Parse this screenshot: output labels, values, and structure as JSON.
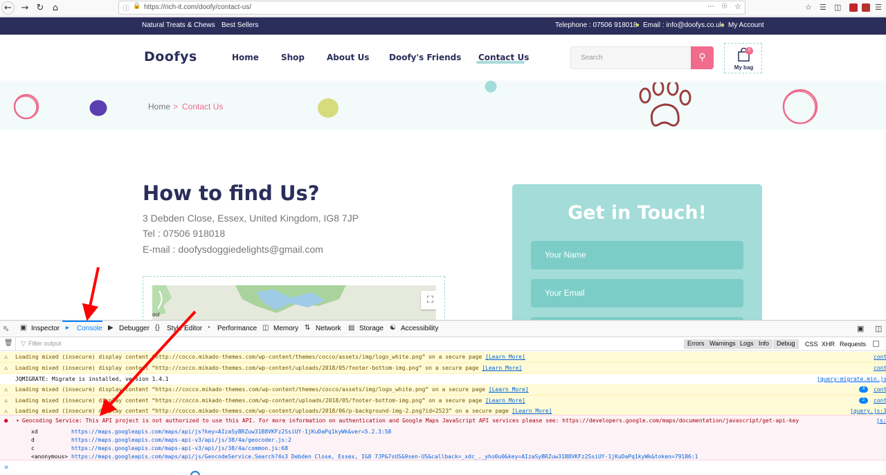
{
  "browser": {
    "url": "https://rich-it.com/doofy/contact-us/",
    "back_icon": "back-arrow-icon",
    "forward_icon": "forward-arrow-icon"
  },
  "topbar": {
    "left": [
      "Natural Treats & Chews",
      "Best Sellers"
    ],
    "telephone": "Telephone : 07506 918018",
    "email": "Email : info@doofys.co.uk",
    "account": "My Account"
  },
  "header": {
    "logo": "Doofys",
    "nav": [
      "Home",
      "Shop",
      "About Us",
      "Doofy's Friends",
      "Contact Us"
    ],
    "search_placeholder": "Search",
    "bag_label": "My bag",
    "bag_count": "0"
  },
  "breadcrumb": {
    "home": "Home",
    "separator": ">",
    "current": "Contact Us"
  },
  "content": {
    "title": "How to find Us?",
    "address": "3 Debden Close, Essex, United Kingdom, IG8 7JP",
    "tel": "Tel : 07506 918018",
    "email": "E-mail : doofysdoggiedelights@gmail.com",
    "map_label": "ool"
  },
  "contact_form": {
    "title": "Get in Touch!",
    "name_placeholder": "Your Name",
    "email_placeholder": "Your Email"
  },
  "devtools": {
    "tabs": [
      "Inspector",
      "Console",
      "Debugger",
      "Style Editor",
      "Performance",
      "Memory",
      "Network",
      "Storage",
      "Accessibility"
    ],
    "filter_placeholder": "Filter output",
    "filters": [
      "Errors",
      "Warnings",
      "Logs",
      "Info",
      "Debug"
    ],
    "filters_right": [
      "CSS",
      "XHR",
      "Requests"
    ],
    "messages": [
      {
        "type": "warn",
        "text": "Loading mixed (insecure) display content “http://cocco.mikado-themes.com/wp-content/themes/cocco/assets/img/logo_white.png” on a secure page",
        "link": "[Learn More]",
        "src": "cont"
      },
      {
        "type": "warn",
        "text": "Loading mixed (insecure) display content “http://cocco.mikado-themes.com/wp-content/uploads/2018/05/footer-bottom-img.png” on a secure page",
        "link": "[Learn More]",
        "src": "cont"
      },
      {
        "type": "plain",
        "text": "JQMIGRATE: Migrate is installed, version 1.4.1",
        "link": "",
        "src": "jquery-migrate.min.js"
      },
      {
        "type": "warn",
        "text": "Loading mixed (insecure) display content “https://cocco.mikado-themes.com/wp-content/themes/cocco/assets/img/logo_white.png” on a secure page",
        "link": "[Learn More]",
        "src": "cont",
        "count": "4"
      },
      {
        "type": "warn",
        "text": "Loading mixed (insecure) display content “https://cocco.mikado-themes.com/wp-content/uploads/2018/05/footer-bottom-img.png” on a secure page",
        "link": "[Learn More]",
        "src": "cont",
        "count": "2"
      },
      {
        "type": "warn",
        "text": "Loading mixed (insecure) display content “http://cocco.mikado-themes.com/wp-content/uploads/2018/06/p-background-img-2.png?id=2523” on a secure page",
        "link": "[Learn More]",
        "src": "jquery.js:3"
      }
    ],
    "error": {
      "text": "Geocoding Service: This API project is not authorized to use this API.  For more information on authentication and Google Maps JavaScript API services please see: https://developers.google.com/maps/documentation/javascript/get-api-key",
      "src": "js:",
      "stack": [
        {
          "fn": "xd",
          "url": "https://maps.googleapis.com/maps/api/js?key=AIzaSyBRZuw31B8VKFz2SsiUY-1jKuDaPq1kyWk&ver=5.2.3:58"
        },
        {
          "fn": "d",
          "url": "https://maps.googleapis.com/maps-api-v3/api/js/38/4a/geocoder.js:2"
        },
        {
          "fn": "c",
          "url": "https://maps.googleapis.com/maps-api-v3/api/js/38/4a/common.js:68"
        },
        {
          "fn": "<anonymous>",
          "url": "https://maps.googleapis.com/maps/api/js/GeocodeService.Search?4s3 Debden Close, Essex, IG8 7JP&7sUS&9sen-US&callback=_xdc_._yho0u0&key=AIzaSyBRZuw31B8VKFz2SsiUY-1jKuDaPq1kyWk&token=79186:1"
        }
      ]
    },
    "prompt": "»"
  },
  "colors": {
    "navy": "#2b2e5a",
    "pink": "#f06b8c",
    "teal": "#a3dcd8",
    "annotation": "#ff0000"
  }
}
